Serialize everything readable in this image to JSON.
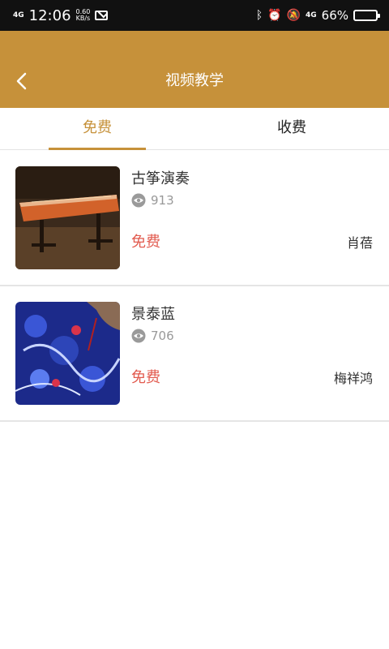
{
  "status_bar": {
    "network_left": "4G",
    "time": "12:06",
    "speed_value": "0.60",
    "speed_unit": "KB/s",
    "network_right": "4G",
    "battery": "66%",
    "battery_level": 0.66
  },
  "header": {
    "title": "视频教学",
    "accent_color": "#c6913a"
  },
  "tabs": [
    {
      "label": "免费",
      "active": true
    },
    {
      "label": "收费",
      "active": false
    }
  ],
  "items": [
    {
      "title": "古筝演奏",
      "views": "913",
      "price": "免费",
      "teacher": "肖蓓"
    },
    {
      "title": "景泰蓝",
      "views": "706",
      "price": "免费",
      "teacher": "梅祥鸿"
    }
  ]
}
